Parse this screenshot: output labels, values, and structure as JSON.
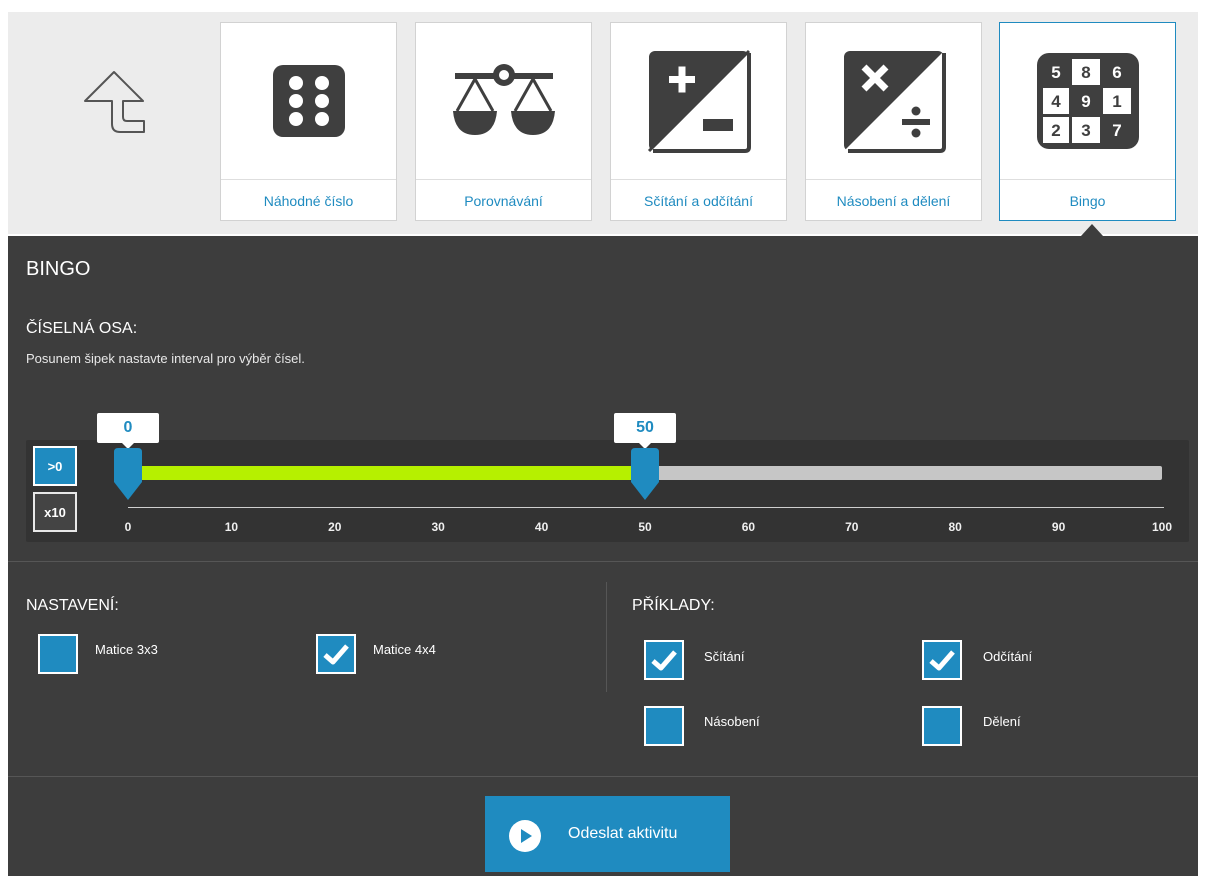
{
  "nav": {
    "back_icon": "back-arrow-icon",
    "tiles": [
      {
        "label": "Náhodné číslo",
        "icon": "dice-icon"
      },
      {
        "label": "Porovnávání",
        "icon": "scales-icon"
      },
      {
        "label": "Sčítání a odčítání",
        "icon": "plus-minus-icon"
      },
      {
        "label": "Násobení a dělení",
        "icon": "times-divide-icon"
      },
      {
        "label": "Bingo",
        "icon": "bingo-grid-icon"
      }
    ],
    "bingo_numbers": [
      "5",
      "8",
      "6",
      "4",
      "9",
      "1",
      "2",
      "3",
      "7"
    ]
  },
  "panel": {
    "title": "BINGO",
    "axis_heading": "ČÍSELNÁ OSA:",
    "axis_description": "Posunem šipek nastavte interval pro výběr čísel.",
    "btn_positive": ">0",
    "btn_x10": "x10",
    "range_min_label": "0",
    "range_max_label": "50",
    "range_min": 0,
    "range_max": 50,
    "axis_ticks": [
      "0",
      "10",
      "20",
      "30",
      "40",
      "50",
      "60",
      "70",
      "80",
      "90",
      "100"
    ]
  },
  "settings": {
    "heading": "NASTAVENÍ:",
    "matrix3": {
      "label": "Matice 3x3",
      "checked": false
    },
    "matrix4": {
      "label": "Matice 4x4",
      "checked": true
    }
  },
  "examples": {
    "heading": "PŘÍKLADY:",
    "addition": {
      "label": "Sčítání",
      "checked": true
    },
    "subtraction": {
      "label": "Odčítání",
      "checked": true
    },
    "multiplication": {
      "label": "Násobení",
      "checked": false
    },
    "division": {
      "label": "Dělení",
      "checked": false
    }
  },
  "submit": {
    "label": "Odeslat aktivitu",
    "icon": "play-icon"
  },
  "colors": {
    "accent": "#1f8bc0",
    "range_fill": "#b6f000",
    "panel_bg": "#3d3d3d"
  }
}
